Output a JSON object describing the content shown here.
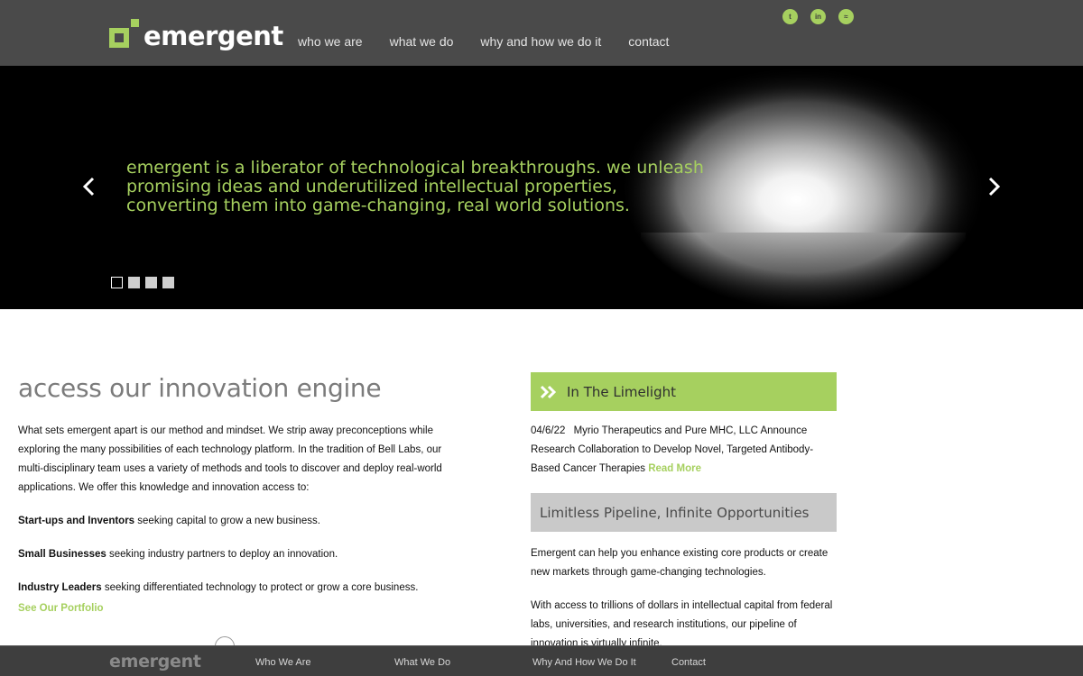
{
  "header": {
    "logo_text": "emergent",
    "nav": [
      {
        "label": "who we are"
      },
      {
        "label": "what we do"
      },
      {
        "label": "why and how we do it"
      },
      {
        "label": "contact"
      }
    ],
    "social": [
      {
        "icon": "twitter-icon",
        "glyph": "t"
      },
      {
        "icon": "linkedin-icon",
        "glyph": "in"
      },
      {
        "icon": "rss-icon",
        "glyph": "≈"
      }
    ]
  },
  "hero": {
    "tagline": "emergent is a liberator of technological breakthroughs. we unleash promising ideas and underutilized intellectual properties, converting them into game-changing, real world solutions.",
    "slide_count": 4,
    "active_slide": 1
  },
  "main": {
    "title": "access our innovation engine",
    "intro": "What sets emergent apart is our method and mindset. We strip away preconceptions while exploring the many possibilities of each technology platform. In the tradition of Bell Labs, our multi-disciplinary team uses a variety of methods and tools to discover and deploy real-world applications. We offer this knowledge and innovation access to:",
    "audiences": [
      {
        "name": "Start-ups and Inventors",
        "desc": " seeking capital to grow a new business."
      },
      {
        "name": "Small Businesses",
        "desc": " seeking industry partners to deploy an innovation."
      },
      {
        "name": "Industry Leaders",
        "desc": " seeking differentiated technology to protect or grow a core business."
      }
    ],
    "portfolio_link": "See Our Portfolio"
  },
  "limelight": {
    "title": "In The Limelight",
    "date": "04/6/22",
    "headline": "Myrio Therapeutics and Pure MHC, LLC Announce Research Collaboration to Develop Novel, Targeted Antibody-Based Cancer Therapies",
    "read_more": "Read More"
  },
  "pipeline": {
    "title": "Limitless Pipeline, Infinite Opportunities",
    "para1": "Emergent can help you enhance existing core products or create new markets through game-changing technologies.",
    "para2": "With access to trillions of dollars in intellectual capital from federal labs, universities, and research institutions, our pipeline of innovation is virtually infinite."
  },
  "footer": {
    "logo_text": "emergent",
    "nav": [
      {
        "label": "Who We Are"
      },
      {
        "label": "What We Do"
      },
      {
        "label": "Why And How We Do It"
      },
      {
        "label": "Contact"
      }
    ]
  },
  "colors": {
    "accent": "#a6d05f",
    "header_bg": "#4a4a4a",
    "footer_bg": "#3e3e3e",
    "grey_bar": "#c9c9c9"
  }
}
